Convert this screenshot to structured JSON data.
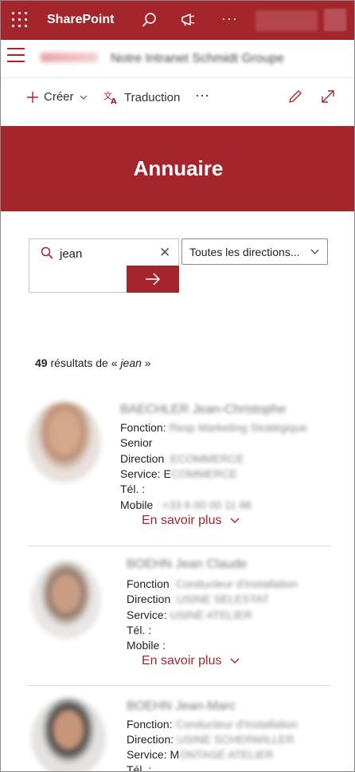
{
  "suite": {
    "app_name": "SharePoint",
    "more": "···"
  },
  "site": {
    "title": "Notre Intranet Schmidt Groupe"
  },
  "command_bar": {
    "create_label": "Créer",
    "translate_label": "Traduction",
    "more": "···"
  },
  "banner": {
    "title": "Annuaire"
  },
  "search": {
    "value": "jean",
    "clear": "✕",
    "filter_selected": "Toutes les directions..."
  },
  "results": {
    "count": "49",
    "text": "résultats de",
    "open_quote": "« ",
    "query": "jean",
    "close_quote": " »"
  },
  "people": [
    {
      "name": "BAECHLER Jean-Christophe",
      "fonction_label": "Fonction:",
      "fonction_value": "Resp Marketing Stratégique",
      "extra_line": "Senior",
      "direction_label": "Direction",
      "direction_value": ": ECOMMERCE",
      "service_label": "Service: E",
      "service_value": "COMMERCE",
      "tel_label": "Tél. :",
      "tel_value": "",
      "mobile_label": "Mobile",
      "mobile_value": ": +33 6 00 00 11 86",
      "more_label": "En savoir plus"
    },
    {
      "name": "BOEHN Jean Claude",
      "fonction_label": "Fonction",
      "fonction_value": ": Conducteur d'Installation",
      "direction_label": "Direction",
      "direction_value": ": USINE SELESTAT",
      "service_label": "Service:",
      "service_value": "USINE ATELIER",
      "tel_label": "Tél. :",
      "tel_value": "",
      "mobile_label": "Mobile :",
      "mobile_value": "",
      "more_label": "En savoir plus"
    },
    {
      "name": "BOEHN Jean-Marc",
      "fonction_label": "Fonction:",
      "fonction_value": "Conducteur d'Installation",
      "direction_label": "Direction:",
      "direction_value": "USINE SCHERWILLER",
      "service_label": "Service: M",
      "service_value": "ONTAGE ATELIER",
      "tel_label": "Tél. :",
      "tel_value": ""
    }
  ],
  "colors": {
    "brand": "#a4262c",
    "link": "#a4262c"
  }
}
